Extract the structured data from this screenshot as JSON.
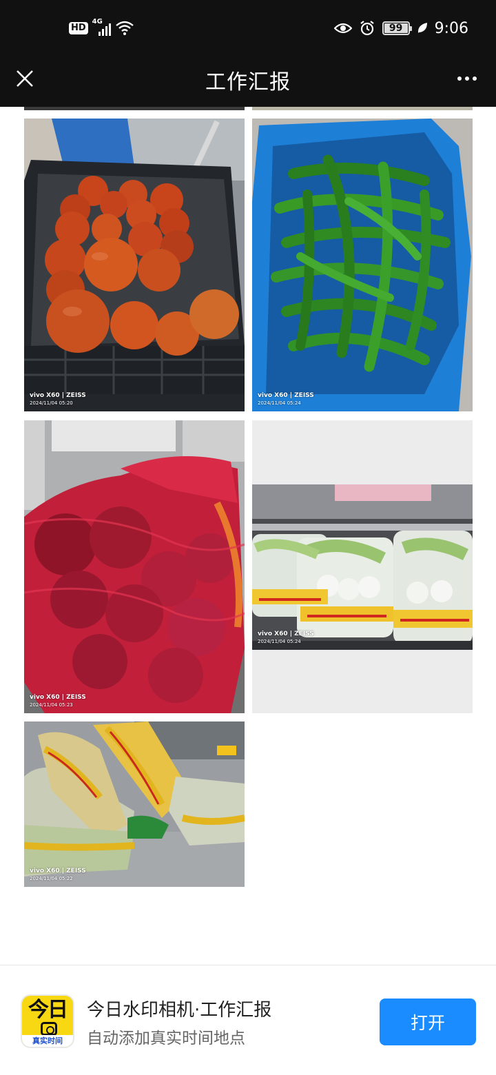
{
  "status_bar": {
    "hd_badge": "HD",
    "network": "4G",
    "battery_level": "99",
    "time": "9:06",
    "icons": [
      "hd-icon",
      "signal-icon",
      "wifi-icon",
      "eye-icon",
      "alarm-icon",
      "battery-icon",
      "leaf-icon"
    ]
  },
  "nav": {
    "title": "工作汇报",
    "close_icon": "close-icon",
    "more_icon": "more-icon"
  },
  "photos": [
    {
      "subject": "tomatoes",
      "brand": "vivo X60 | ZEISS",
      "date": "2024/11/04 05:20"
    },
    {
      "subject": "green-peppers",
      "brand": "vivo X60 | ZEISS",
      "date": "2024/11/04 05:24"
    },
    {
      "subject": "red-onions",
      "brand": "vivo X60 | ZEISS",
      "date": "2024/11/04 05:23"
    },
    {
      "subject": "bok-choy-bags",
      "brand": "vivo X60 | ZEISS",
      "date": "2024/11/04 05:24"
    },
    {
      "subject": "bagged-vegetables",
      "brand": "vivo X60 | ZEISS",
      "date": "2024/11/04 05:22"
    }
  ],
  "app_banner": {
    "icon_text": "今日",
    "icon_subtext": "真实时间",
    "name": "今日水印相机·工作汇报",
    "description": "自动添加真实时间地点",
    "open_label": "打开"
  },
  "colors": {
    "status_bg": "#111111",
    "open_button": "#1a8cff",
    "app_icon": "#f8d812"
  }
}
